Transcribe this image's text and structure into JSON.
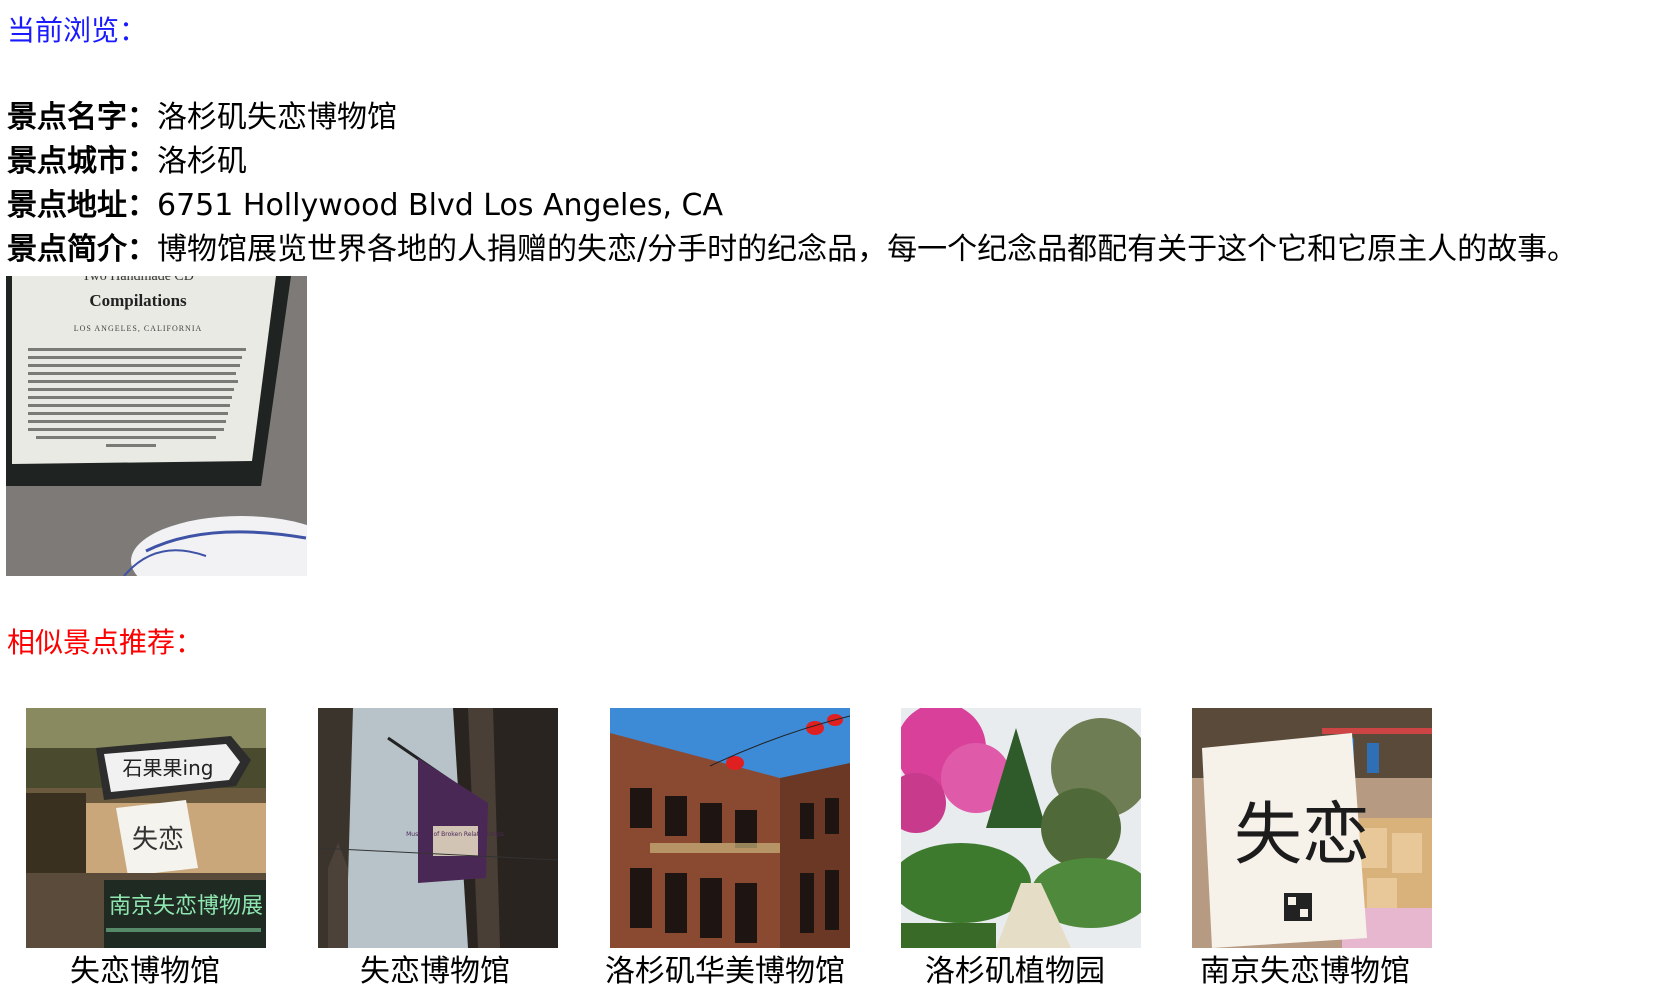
{
  "current": {
    "label": "当前浏览："
  },
  "attraction": {
    "name_key": "景点名字：",
    "name": "洛杉矶失恋博物馆",
    "city_key": "景点城市：",
    "city": "洛杉矶",
    "address_key": "景点地址：",
    "address": "6751 Hollywood Blvd Los Angeles, CA",
    "intro_key": "景点简介：",
    "intro": "博物馆展览世界各地的人捐赠的失恋/分手时的纪念品，每一个纪念品都配有关于这个它和它原主人的故事。",
    "photo": {
      "card_heading": "Two Handmade CD",
      "card_title": "Compilations",
      "card_subtitle": "LOS ANGELES, CALIFORNIA"
    }
  },
  "recommendations": {
    "label": "相似景点推荐：",
    "items": [
      {
        "name": "失恋博物馆",
        "sign_top": "石果果ing",
        "sign_card": "失恋",
        "sign_board": "南京失恋博物展"
      },
      {
        "name": "失恋博物馆",
        "flag_text": "Museum of Broken Relationships"
      },
      {
        "name": "洛杉矶华美博物馆"
      },
      {
        "name": "洛杉矶植物园"
      },
      {
        "name": "南京失恋博物馆",
        "poster_text": "失恋"
      }
    ]
  },
  "colors": {
    "current_label": "#1a1aff",
    "recommend_label": "#ff0000"
  }
}
